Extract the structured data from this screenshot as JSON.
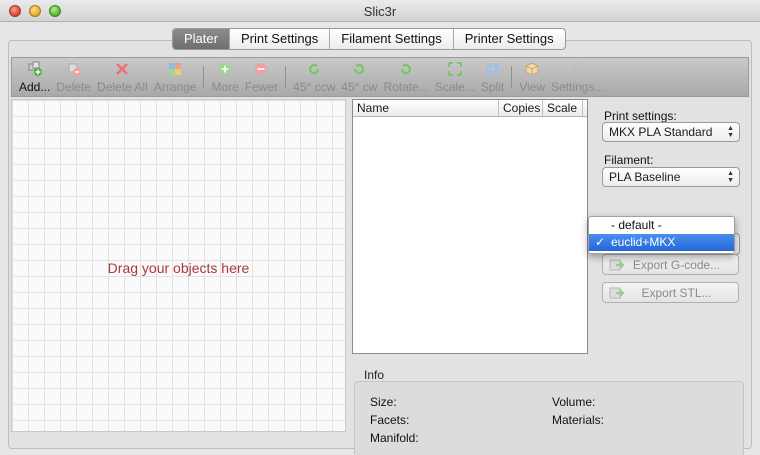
{
  "window": {
    "title": "Slic3r"
  },
  "tabs": [
    {
      "label": "Plater",
      "active": true
    },
    {
      "label": "Print Settings",
      "active": false
    },
    {
      "label": "Filament Settings",
      "active": false
    },
    {
      "label": "Printer Settings",
      "active": false
    }
  ],
  "toolbar": {
    "add": "Add...",
    "delete": "Delete",
    "delete_all": "Delete All",
    "arrange": "Arrange",
    "more": "More",
    "fewer": "Fewer",
    "rotate_ccw": "45° ccw",
    "rotate_cw": "45° cw",
    "rotate": "Rotate...",
    "scale": "Scale...",
    "split": "Split",
    "view": "View",
    "settings": "Settings..."
  },
  "canvas": {
    "hint": "Drag your objects here"
  },
  "object_list": {
    "columns": [
      "Name",
      "Copies",
      "Scale"
    ]
  },
  "print_settings": {
    "label": "Print settings:",
    "value": "MKX PLA Standard"
  },
  "filament": {
    "label": "Filament:",
    "value": "PLA Baseline"
  },
  "printer_dropdown": {
    "options": [
      "- default -",
      "euclid+MKX"
    ],
    "selected": "euclid+MKX",
    "check": "✓"
  },
  "buttons": {
    "export_gcode": "Export G-code...",
    "export_stl": "Export STL..."
  },
  "info": {
    "title": "Info",
    "size": "Size:",
    "volume": "Volume:",
    "facets": "Facets:",
    "materials": "Materials:",
    "manifold": "Manifold:"
  },
  "colors": {
    "hint": "#a83a3a",
    "selection": "#2466d8",
    "active_tab": "#7a7a7a"
  }
}
